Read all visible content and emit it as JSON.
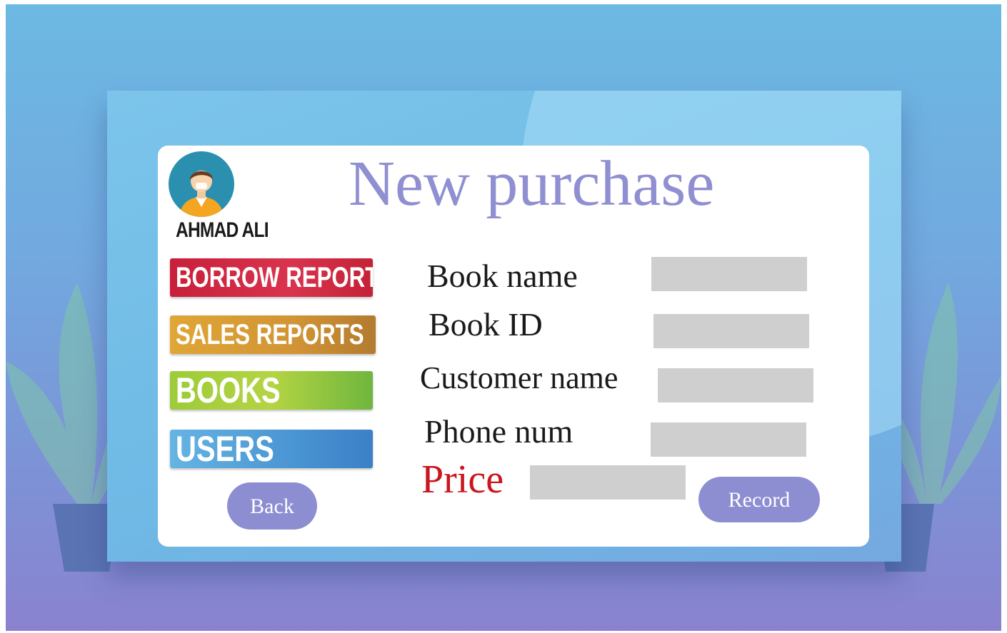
{
  "page": {
    "title": "New purchase"
  },
  "user": {
    "name": "AHMAD ALI"
  },
  "sidebar": {
    "items": [
      {
        "label": "BORROW REPORTS"
      },
      {
        "label": "SALES REPORTS"
      },
      {
        "label": "BOOKS"
      },
      {
        "label": "USERS"
      }
    ]
  },
  "form": {
    "book_name_label": "Book name",
    "book_id_label": "Book ID",
    "customer_name_label": "Customer name",
    "phone_label": "Phone num",
    "price_label": "Price",
    "book_name_value": "",
    "book_id_value": "",
    "customer_name_value": "",
    "phone_value": "",
    "price_value": ""
  },
  "buttons": {
    "back_label": "Back",
    "record_label": "Record"
  },
  "colors": {
    "title": "#8f8fd1",
    "pill_button": "#8d8dd2",
    "borrow_reports": "#c8203a",
    "sales_reports": "#d29434",
    "books": "#a5cf3c",
    "users": "#4a95d3",
    "price_label": "#c9161f",
    "field": "#cfcfcf"
  }
}
